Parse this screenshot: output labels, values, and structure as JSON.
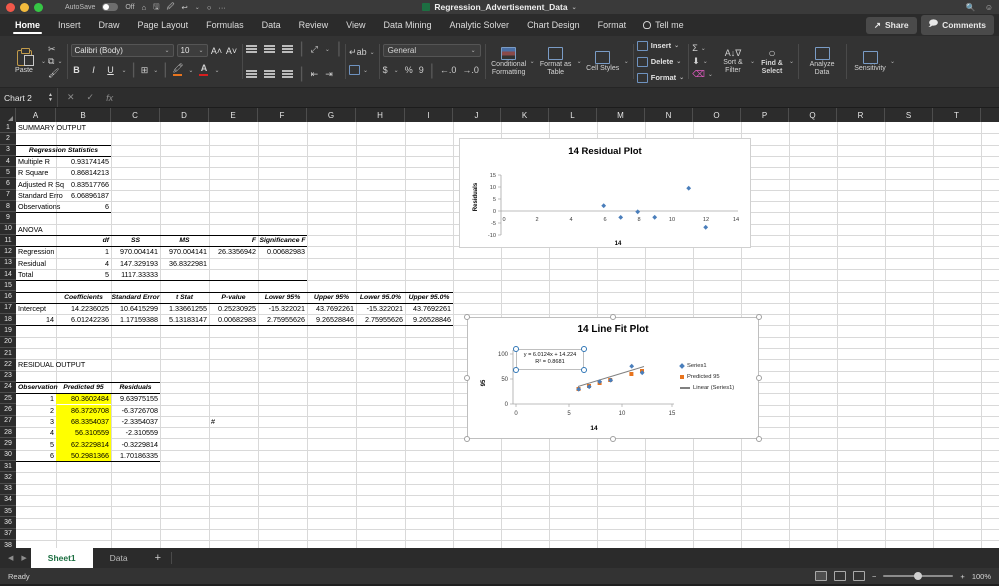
{
  "titlebar": {
    "document_title": "Regression_Advertisement_Data",
    "autosave_label": "AutoSave",
    "autosave_state": "Off",
    "search_icon": "search-icon",
    "account_icon": "account-icon"
  },
  "ribbon_tabs": {
    "tabs": [
      {
        "label": "Home",
        "active": true
      },
      {
        "label": "Insert",
        "active": false
      },
      {
        "label": "Draw",
        "active": false
      },
      {
        "label": "Page Layout",
        "active": false
      },
      {
        "label": "Formulas",
        "active": false
      },
      {
        "label": "Data",
        "active": false
      },
      {
        "label": "Review",
        "active": false
      },
      {
        "label": "View",
        "active": false
      },
      {
        "label": "Data Mining",
        "active": false
      },
      {
        "label": "Analytic Solver",
        "active": false
      },
      {
        "label": "Chart Design",
        "active": false
      },
      {
        "label": "Format",
        "active": false
      }
    ],
    "tell_me": "Tell me",
    "share": "Share",
    "comments": "Comments"
  },
  "ribbon": {
    "paste_label": "Paste",
    "font_name": "Calibri (Body)",
    "font_size": "10",
    "bold": "B",
    "italic": "I",
    "underline": "U",
    "number_format": "General",
    "currency": "$",
    "percent": "%",
    "comma": "9",
    "conditional_formatting": "Conditional Formatting",
    "format_as_table": "Format as Table",
    "cell_styles": "Cell Styles",
    "insert": "Insert",
    "delete": "Delete",
    "format": "Format",
    "sort_filter": "Sort & Filter",
    "find_select": "Find & Select",
    "analyze_data": "Analyze Data",
    "sensitivity": "Sensitivity"
  },
  "formula_bar": {
    "name_box": "Chart 2",
    "formula_value": "",
    "cancel_icon": "cancel-icon",
    "accept_icon": "accept-icon",
    "function_icon": "fx-icon"
  },
  "grid": {
    "columns": [
      "A",
      "B",
      "C",
      "D",
      "E",
      "F",
      "G",
      "H",
      "I",
      "J",
      "K",
      "L",
      "M",
      "N",
      "O",
      "P",
      "Q",
      "R",
      "S",
      "T"
    ],
    "rows": [
      1,
      2,
      3,
      4,
      5,
      6,
      7,
      8,
      9,
      10,
      11,
      12,
      13,
      14,
      15,
      16,
      17,
      18,
      19,
      20,
      21,
      22,
      23,
      24,
      25,
      26,
      27,
      28,
      29,
      30,
      31,
      32,
      33,
      34,
      35,
      36,
      37,
      38
    ],
    "cells": [
      {
        "row": 1,
        "col": 0,
        "text": "SUMMARY OUTPUT",
        "align": "l",
        "style": "plain"
      },
      {
        "row": 3,
        "col": 0,
        "text": "Regression Statistics",
        "align": "c",
        "style": "italic",
        "span": 2
      },
      {
        "row": 4,
        "col": 0,
        "text": "Multiple R",
        "align": "l",
        "style": "plain"
      },
      {
        "row": 4,
        "col": 1,
        "text": "0.93174145",
        "align": "r",
        "style": "plain"
      },
      {
        "row": 5,
        "col": 0,
        "text": "R Square",
        "align": "l",
        "style": "plain"
      },
      {
        "row": 5,
        "col": 1,
        "text": "0.86814213",
        "align": "r",
        "style": "plain"
      },
      {
        "row": 6,
        "col": 0,
        "text": "Adjusted R Sq",
        "align": "l",
        "style": "plain"
      },
      {
        "row": 6,
        "col": 1,
        "text": "0.83517766",
        "align": "r",
        "style": "plain"
      },
      {
        "row": 7,
        "col": 0,
        "text": "Standard Erro",
        "align": "l",
        "style": "plain"
      },
      {
        "row": 7,
        "col": 1,
        "text": "6.06896187",
        "align": "r",
        "style": "plain"
      },
      {
        "row": 8,
        "col": 0,
        "text": "Observations",
        "align": "l",
        "style": "plain"
      },
      {
        "row": 8,
        "col": 1,
        "text": "6",
        "align": "r",
        "style": "plain"
      },
      {
        "row": 10,
        "col": 0,
        "text": "ANOVA",
        "align": "l",
        "style": "plain"
      },
      {
        "row": 11,
        "col": 1,
        "text": "df",
        "align": "r",
        "style": "italic"
      },
      {
        "row": 11,
        "col": 2,
        "text": "SS",
        "align": "c",
        "style": "italic"
      },
      {
        "row": 11,
        "col": 3,
        "text": "MS",
        "align": "c",
        "style": "italic"
      },
      {
        "row": 11,
        "col": 4,
        "text": "F",
        "align": "r",
        "style": "italic"
      },
      {
        "row": 11,
        "col": 5,
        "text": "Significance F",
        "align": "c",
        "style": "italic"
      },
      {
        "row": 12,
        "col": 0,
        "text": "Regression",
        "align": "l",
        "style": "plain"
      },
      {
        "row": 12,
        "col": 1,
        "text": "1",
        "align": "r",
        "style": "plain"
      },
      {
        "row": 12,
        "col": 2,
        "text": "970.004141",
        "align": "r",
        "style": "plain"
      },
      {
        "row": 12,
        "col": 3,
        "text": "970.004141",
        "align": "r",
        "style": "plain"
      },
      {
        "row": 12,
        "col": 4,
        "text": "26.3356942",
        "align": "r",
        "style": "plain"
      },
      {
        "row": 12,
        "col": 5,
        "text": "0.00682983",
        "align": "r",
        "style": "plain"
      },
      {
        "row": 13,
        "col": 0,
        "text": "Residual",
        "align": "l",
        "style": "plain"
      },
      {
        "row": 13,
        "col": 1,
        "text": "4",
        "align": "r",
        "style": "plain"
      },
      {
        "row": 13,
        "col": 2,
        "text": "147.329193",
        "align": "r",
        "style": "plain"
      },
      {
        "row": 13,
        "col": 3,
        "text": "36.8322981",
        "align": "r",
        "style": "plain"
      },
      {
        "row": 14,
        "col": 0,
        "text": "Total",
        "align": "l",
        "style": "plain"
      },
      {
        "row": 14,
        "col": 1,
        "text": "5",
        "align": "r",
        "style": "plain"
      },
      {
        "row": 14,
        "col": 2,
        "text": "1117.33333",
        "align": "r",
        "style": "plain"
      },
      {
        "row": 16,
        "col": 1,
        "text": "Coefficients",
        "align": "c",
        "style": "italic"
      },
      {
        "row": 16,
        "col": 2,
        "text": "Standard Error",
        "align": "c",
        "style": "italic"
      },
      {
        "row": 16,
        "col": 3,
        "text": "t Stat",
        "align": "c",
        "style": "italic"
      },
      {
        "row": 16,
        "col": 4,
        "text": "P-value",
        "align": "c",
        "style": "italic"
      },
      {
        "row": 16,
        "col": 5,
        "text": "Lower 95%",
        "align": "c",
        "style": "italic"
      },
      {
        "row": 16,
        "col": 6,
        "text": "Upper 95%",
        "align": "c",
        "style": "italic"
      },
      {
        "row": 16,
        "col": 7,
        "text": "Lower 95.0%",
        "align": "c",
        "style": "italic"
      },
      {
        "row": 16,
        "col": 8,
        "text": "Upper 95.0%",
        "align": "c",
        "style": "italic"
      },
      {
        "row": 17,
        "col": 0,
        "text": "Intercept",
        "align": "l",
        "style": "plain"
      },
      {
        "row": 17,
        "col": 1,
        "text": "14.2236025",
        "align": "r",
        "style": "plain"
      },
      {
        "row": 17,
        "col": 2,
        "text": "10.6415299",
        "align": "r",
        "style": "plain"
      },
      {
        "row": 17,
        "col": 3,
        "text": "1.33661255",
        "align": "r",
        "style": "plain"
      },
      {
        "row": 17,
        "col": 4,
        "text": "0.25230925",
        "align": "r",
        "style": "plain"
      },
      {
        "row": 17,
        "col": 5,
        "text": "-15.322021",
        "align": "r",
        "style": "plain"
      },
      {
        "row": 17,
        "col": 6,
        "text": "43.7692261",
        "align": "r",
        "style": "plain"
      },
      {
        "row": 17,
        "col": 7,
        "text": "-15.322021",
        "align": "r",
        "style": "plain"
      },
      {
        "row": 17,
        "col": 8,
        "text": "43.7692261",
        "align": "r",
        "style": "plain"
      },
      {
        "row": 18,
        "col": 0,
        "text": "14",
        "align": "r",
        "style": "plain"
      },
      {
        "row": 18,
        "col": 1,
        "text": "6.01242236",
        "align": "r",
        "style": "plain"
      },
      {
        "row": 18,
        "col": 2,
        "text": "1.17159388",
        "align": "r",
        "style": "plain"
      },
      {
        "row": 18,
        "col": 3,
        "text": "5.13183147",
        "align": "r",
        "style": "plain"
      },
      {
        "row": 18,
        "col": 4,
        "text": "0.00682983",
        "align": "r",
        "style": "plain"
      },
      {
        "row": 18,
        "col": 5,
        "text": "2.75955626",
        "align": "r",
        "style": "plain"
      },
      {
        "row": 18,
        "col": 6,
        "text": "9.26528846",
        "align": "r",
        "style": "plain"
      },
      {
        "row": 18,
        "col": 7,
        "text": "2.75955626",
        "align": "r",
        "style": "plain"
      },
      {
        "row": 18,
        "col": 8,
        "text": "9.26528846",
        "align": "r",
        "style": "plain"
      },
      {
        "row": 22,
        "col": 0,
        "text": "RESIDUAL OUTPUT",
        "align": "l",
        "style": "plain"
      },
      {
        "row": 24,
        "col": 0,
        "text": "Observation",
        "align": "l",
        "style": "italic"
      },
      {
        "row": 24,
        "col": 1,
        "text": "Predicted 95",
        "align": "c",
        "style": "italic"
      },
      {
        "row": 24,
        "col": 2,
        "text": "Residuals",
        "align": "c",
        "style": "italic"
      },
      {
        "row": 25,
        "col": 0,
        "text": "1",
        "align": "r",
        "style": "plain"
      },
      {
        "row": 25,
        "col": 1,
        "text": "80.3602484",
        "align": "r",
        "style": "highlight"
      },
      {
        "row": 25,
        "col": 2,
        "text": "9.63975155",
        "align": "r",
        "style": "plain"
      },
      {
        "row": 26,
        "col": 0,
        "text": "2",
        "align": "r",
        "style": "plain"
      },
      {
        "row": 26,
        "col": 1,
        "text": "86.3726708",
        "align": "r",
        "style": "highlight"
      },
      {
        "row": 26,
        "col": 2,
        "text": "-6.3726708",
        "align": "r",
        "style": "plain"
      },
      {
        "row": 27,
        "col": 0,
        "text": "3",
        "align": "r",
        "style": "plain"
      },
      {
        "row": 27,
        "col": 1,
        "text": "68.3354037",
        "align": "r",
        "style": "highlight"
      },
      {
        "row": 27,
        "col": 2,
        "text": "-2.3354037",
        "align": "r",
        "style": "plain"
      },
      {
        "row": 27,
        "col": 4,
        "text": "#",
        "align": "l",
        "style": "plain"
      },
      {
        "row": 28,
        "col": 0,
        "text": "4",
        "align": "r",
        "style": "plain"
      },
      {
        "row": 28,
        "col": 1,
        "text": "56.310559",
        "align": "r",
        "style": "highlight"
      },
      {
        "row": 28,
        "col": 2,
        "text": "-2.310559",
        "align": "r",
        "style": "plain"
      },
      {
        "row": 29,
        "col": 0,
        "text": "5",
        "align": "r",
        "style": "plain"
      },
      {
        "row": 29,
        "col": 1,
        "text": "62.3229814",
        "align": "r",
        "style": "highlight"
      },
      {
        "row": 29,
        "col": 2,
        "text": "-0.3229814",
        "align": "r",
        "style": "plain"
      },
      {
        "row": 30,
        "col": 0,
        "text": "6",
        "align": "r",
        "style": "plain"
      },
      {
        "row": 30,
        "col": 1,
        "text": "50.2981366",
        "align": "r",
        "style": "highlight"
      },
      {
        "row": 30,
        "col": 2,
        "text": "1.70186335",
        "align": "r",
        "style": "plain"
      }
    ]
  },
  "chart_data": [
    {
      "name": "residual-plot",
      "type": "scatter",
      "title": "14  Residual Plot",
      "xlabel": "14",
      "ylabel": "Residuals",
      "xlim": [
        0,
        14
      ],
      "ylim": [
        -10,
        15
      ],
      "xticks": [
        0,
        2,
        4,
        6,
        8,
        10,
        12,
        14
      ],
      "yticks": [
        -10,
        -5,
        0,
        5,
        10,
        15
      ],
      "grid": false,
      "legend": "none",
      "series": [
        {
          "name": "Residuals",
          "color": "#4a7ebb",
          "marker": "diamond",
          "points": [
            {
              "x": 6,
              "y": 1.70186335
            },
            {
              "x": 7,
              "y": -2.3354037
            },
            {
              "x": 8,
              "y": -0.3229814
            },
            {
              "x": 9,
              "y": -2.310559
            },
            {
              "x": 11,
              "y": 9.63975155
            },
            {
              "x": 12,
              "y": -6.3726708
            }
          ]
        }
      ]
    },
    {
      "name": "line-fit-plot",
      "type": "scatter",
      "title": "14 Line Fit  Plot",
      "xlabel": "14",
      "ylabel": "95",
      "xlim": [
        0,
        15
      ],
      "ylim": [
        0,
        110
      ],
      "xticks": [
        0,
        5,
        10,
        15
      ],
      "yticks": [
        0,
        50,
        100
      ],
      "grid": false,
      "legend": "right",
      "annotation_line1": "y = 6.0124x + 14.224",
      "annotation_line2": "R² = 0.8681",
      "legend_entries": [
        {
          "label": "Series1",
          "color": "#4a7ebb",
          "marker": "diamond"
        },
        {
          "label": "Predicted 95",
          "color": "#e8741e",
          "marker": "square"
        },
        {
          "label": "Linear (Series1)",
          "color": "#808080",
          "marker": "line"
        }
      ],
      "series": [
        {
          "name": "Series1",
          "color": "#4a7ebb",
          "marker": "diamond",
          "points": [
            {
              "x": 6,
              "y": 52.0
            },
            {
              "x": 7,
              "y": 66.0
            },
            {
              "x": 8,
              "y": 68.0
            },
            {
              "x": 9,
              "y": 60.0
            },
            {
              "x": 11,
              "y": 90.0
            },
            {
              "x": 12,
              "y": 80.0
            }
          ]
        },
        {
          "name": "Predicted 95",
          "color": "#e8741e",
          "marker": "square",
          "points": [
            {
              "x": 6,
              "y": 50.2981366
            },
            {
              "x": 7,
              "y": 56.310559
            },
            {
              "x": 8,
              "y": 62.3229814
            },
            {
              "x": 9,
              "y": 68.3354037
            },
            {
              "x": 11,
              "y": 80.3602484
            },
            {
              "x": 12,
              "y": 86.3726708
            }
          ]
        }
      ],
      "trendline": {
        "slope": 6.0124,
        "intercept": 14.224,
        "color": "#808080"
      }
    }
  ],
  "sheet_tabs": {
    "tabs": [
      {
        "label": "Sheet1",
        "active": true
      },
      {
        "label": "Data",
        "active": false
      }
    ],
    "add_label": "+",
    "prev_icon": "prev-sheet-icon",
    "next_icon": "next-sheet-icon"
  },
  "status_bar": {
    "status": "Ready",
    "zoom_level": "100%",
    "zoom_minus": "−",
    "zoom_plus": "+",
    "view_normal": "normal-view-icon",
    "view_layout": "page-layout-icon",
    "view_break": "page-break-icon"
  }
}
